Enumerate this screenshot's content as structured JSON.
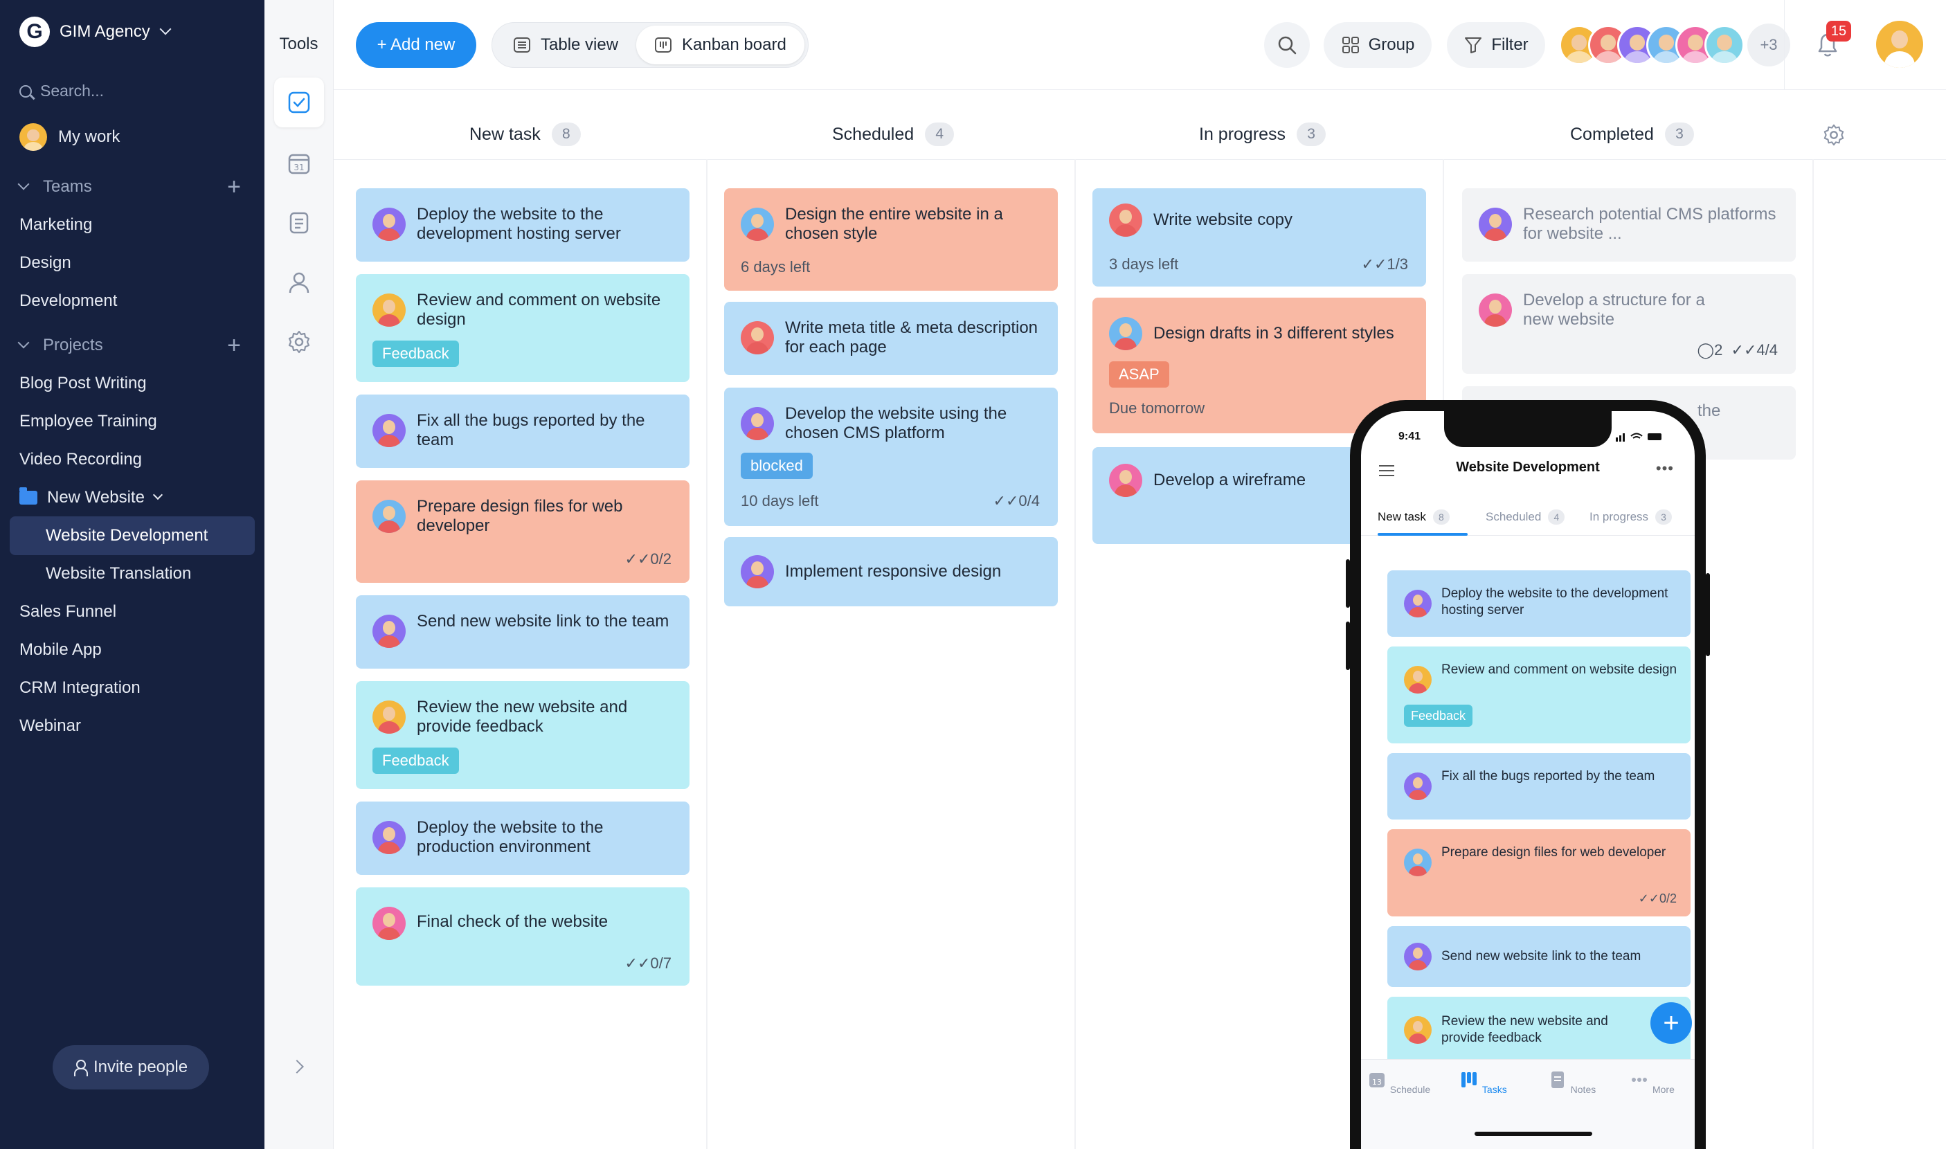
{
  "colors": {
    "sidebar": "#16213f",
    "accent": "#1f8cf0",
    "card_blue": "#b8ddf8",
    "card_cyan": "#b9eef6",
    "card_salmon": "#f9b9a4",
    "card_grey": "#f2f3f5",
    "badge_red": "#ea3a3a"
  },
  "sidebar": {
    "brand": "GIM Agency",
    "search_placeholder": "Search...",
    "my_work": "My work",
    "teams_label": "Teams",
    "teams": [
      "Marketing",
      "Design",
      "Development"
    ],
    "projects_label": "Projects",
    "projects": [
      "Blog Post Writing",
      "Employee Training",
      "Video Recording"
    ],
    "folder": "New Website",
    "folder_items": [
      "Website Development",
      "Website Translation"
    ],
    "more_projects": [
      "Sales Funnel",
      "Mobile App",
      "CRM Integration",
      "Webinar"
    ],
    "invite": "Invite people"
  },
  "tools": {
    "label": "Tools",
    "icons": [
      "tasks-icon",
      "calendar-icon",
      "notes-icon",
      "contacts-icon",
      "settings-icon"
    ],
    "calendar_day": "31"
  },
  "toolbar": {
    "add_new": "+ Add new",
    "table_view": "Table view",
    "kanban_board": "Kanban board",
    "group": "Group",
    "filter": "Filter",
    "more_members": "+3",
    "notifications": "15"
  },
  "columns": [
    {
      "name": "New task",
      "count": "8"
    },
    {
      "name": "Scheduled",
      "count": "4"
    },
    {
      "name": "In progress",
      "count": "3"
    },
    {
      "name": "Completed",
      "count": "3"
    }
  ],
  "new_task": [
    {
      "title": "Deploy the website to the development hosting server"
    },
    {
      "title": "Review and comment on website design",
      "tag": "Feedback"
    },
    {
      "title": "Fix all the bugs reported by the team"
    },
    {
      "title": "Prepare design files for web developer",
      "checklist": "0/2"
    },
    {
      "title": "Send new website link to the team"
    },
    {
      "title": "Review the new website and provide feedback",
      "tag": "Feedback"
    },
    {
      "title": "Deploy the website to the production environment"
    },
    {
      "title": "Final check of the website",
      "checklist": "0/7"
    }
  ],
  "scheduled": [
    {
      "title": "Design the entire website in a chosen style",
      "due": "6 days left"
    },
    {
      "title": "Write meta title & meta description for each page"
    },
    {
      "title": "Develop the website using the chosen CMS platform",
      "tag": "blocked",
      "due": "10 days left",
      "checklist": "0/4"
    },
    {
      "title": "Implement responsive design"
    }
  ],
  "in_progress": [
    {
      "title": "Write website copy",
      "due": "3 days left",
      "checklist": "1/3"
    },
    {
      "title": "Design drafts in 3 different styles",
      "tag": "ASAP",
      "due": "Due tomorrow"
    },
    {
      "title": "Develop a wireframe"
    }
  ],
  "completed": [
    {
      "title": "Research potential CMS platforms for website ..."
    },
    {
      "title": "Develop a structure for a new website",
      "comments": "2",
      "checklist": "4/4"
    },
    {
      "title": "the"
    }
  ],
  "phone": {
    "time": "9:41",
    "title": "Website Development",
    "tabs": [
      {
        "name": "New task",
        "count": "8"
      },
      {
        "name": "Scheduled",
        "count": "4"
      },
      {
        "name": "In progress",
        "count": "3"
      }
    ],
    "cards": [
      {
        "title": "Deploy the website to the development hosting server"
      },
      {
        "title": "Review and comment on website design",
        "tag": "Feedback"
      },
      {
        "title": "Fix all the bugs reported by the team"
      },
      {
        "title": "Prepare design files for web developer",
        "checklist": "0/2"
      },
      {
        "title": "Send new website link to the team"
      },
      {
        "title": "Review the new website and provide feedback"
      }
    ],
    "fab": "+",
    "nav": [
      {
        "label": "Schedule",
        "day": "13"
      },
      {
        "label": "Tasks"
      },
      {
        "label": "Notes"
      },
      {
        "label": "More"
      }
    ]
  }
}
